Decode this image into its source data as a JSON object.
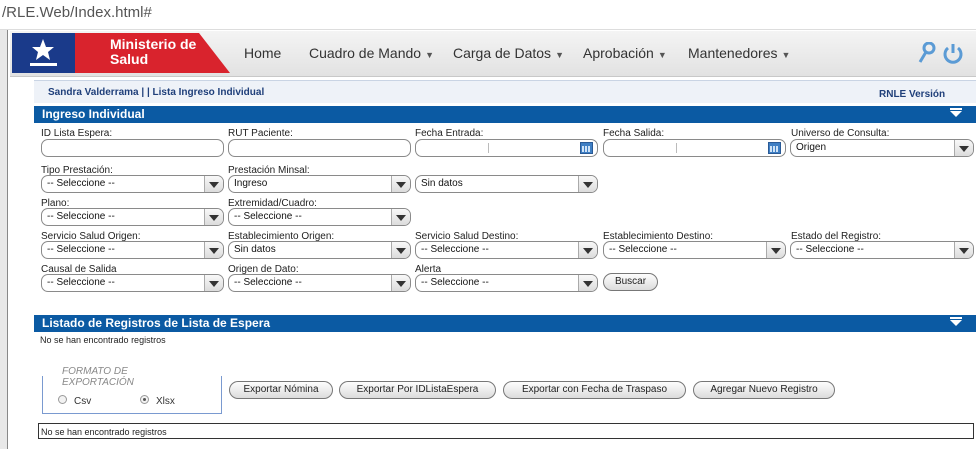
{
  "browser": {
    "url": "/RLE.Web/Index.html#"
  },
  "header": {
    "brand_line1": "Ministerio de",
    "brand_line2": "Salud",
    "nav": [
      {
        "label": "Home",
        "has_caret": false
      },
      {
        "label": "Cuadro de Mando",
        "has_caret": true
      },
      {
        "label": "Carga de Datos",
        "has_caret": true
      },
      {
        "label": "Aprobación",
        "has_caret": true
      },
      {
        "label": "Mantenedores",
        "has_caret": true
      }
    ]
  },
  "userbar": {
    "user": "Sandra Valderrama | | Lista Ingreso Individual",
    "version": "RNLE Versión"
  },
  "ingreso": {
    "title": "Ingreso Individual",
    "labels": {
      "id_lista": "ID Lista Espera:",
      "rut": "RUT Paciente:",
      "fecha_entrada": "Fecha Entrada:",
      "fecha_salida": "Fecha Salida:",
      "universo": "Universo de Consulta:",
      "tipo_prestacion": "Tipo Prestación:",
      "prestacion_minsal": "Prestación Minsal:",
      "plano": "Plano:",
      "extremidad": "Extremidad/Cuadro:",
      "ss_origen": "Servicio Salud Origen:",
      "est_origen": "Establecimiento Origen:",
      "ss_destino": "Servicio Salud Destino:",
      "est_destino": "Establecimiento Destino:",
      "estado": "Estado del Registro:",
      "causal": "Causal de Salida",
      "origen_dato": "Origen de Dato:",
      "alerta": "Alerta"
    },
    "values": {
      "universo": "Origen",
      "tipo_prestacion": "-- Seleccione --",
      "prestacion_minsal": "Ingreso",
      "prestacion_extra": "Sin datos",
      "plano": "-- Seleccione --",
      "extremidad": "-- Seleccione --",
      "ss_origen": "-- Seleccione --",
      "est_origen": "Sin datos",
      "ss_destino": "-- Seleccione --",
      "est_destino": "-- Seleccione --",
      "estado": "-- Seleccione --",
      "causal": "-- Seleccione --",
      "origen_dato": "-- Seleccione --",
      "alerta": "-- Seleccione --"
    },
    "buscar": "Buscar"
  },
  "listado": {
    "title": "Listado de Registros de Lista de Espera",
    "empty_msg": "No se han encontrado registros",
    "export_legend_1": "FORMATO DE",
    "export_legend_2": "EXPORTACIÓN",
    "radio_csv": "Csv",
    "radio_xlsx": "Xlsx",
    "selected_format": "Xlsx",
    "buttons": [
      "Exportar Nómina",
      "Exportar Por IDListaEspera",
      "Exportar con Fecha de Traspaso",
      "Agregar Nuevo Registro"
    ],
    "bottom_msg": "No se han encontrado registros"
  }
}
